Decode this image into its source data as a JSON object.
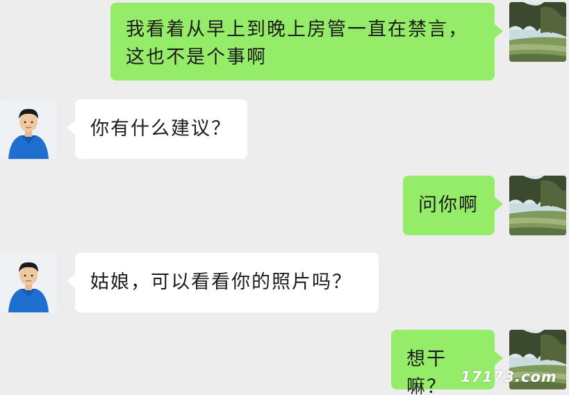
{
  "messages": [
    {
      "sender": "me",
      "text": "我看着从早上到晚上房管一直在禁言，\n这也不是个事啊"
    },
    {
      "sender": "other",
      "text": "你有什么建议？"
    },
    {
      "sender": "me",
      "text": "问你啊"
    },
    {
      "sender": "other",
      "text": "姑娘，可以看看你的照片吗？"
    },
    {
      "sender": "me",
      "text": "想干嘛？"
    }
  ],
  "watermark": "17173.com",
  "colors": {
    "background": "#ededed",
    "my_bubble": "#95ec69",
    "other_bubble": "#ffffff"
  },
  "icons": {
    "my_avatar": "landscape-photo-avatar",
    "other_avatar": "boy-in-blue-avatar"
  }
}
